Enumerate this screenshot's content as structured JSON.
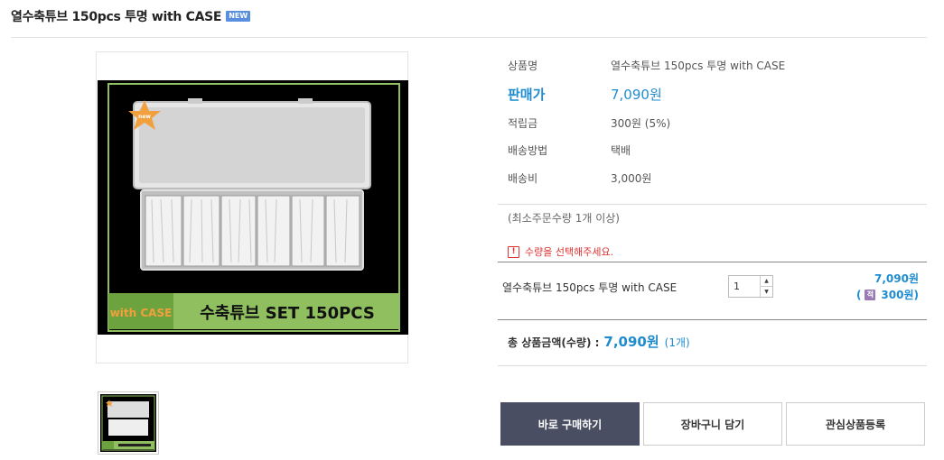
{
  "product": {
    "title": "열수축튜브 150pcs 투명 with CASE",
    "new_badge": "NEW"
  },
  "image": {
    "banner_left": "with CASE",
    "banner_right": "수축튜브 SET 150PCS",
    "star_label": "new"
  },
  "info": {
    "rows": [
      {
        "label": "상품명",
        "value": "열수축튜브 150pcs 투명 with CASE"
      },
      {
        "label": "판매가",
        "value": "7,090원"
      },
      {
        "label": "적립금",
        "value": "300원 (5%)"
      },
      {
        "label": "배송방법",
        "value": "택배"
      },
      {
        "label": "배송비",
        "value": "3,000원"
      }
    ],
    "min_qty": "(최소주문수량 1개 이상)",
    "warning": "수량을 선택해주세요."
  },
  "option": {
    "name": "열수축튜브 150pcs 투명 with CASE",
    "qty": "1",
    "price": "7,090원",
    "mileage_open": "(",
    "mileage": "300원)"
  },
  "total": {
    "label": "총 상품금액(수량) :",
    "amount": "7,090원",
    "count": "(1개)"
  },
  "buttons": {
    "buy": "바로 구매하기",
    "cart": "장바구니 담기",
    "wish": "관심상품등록"
  },
  "colors": {
    "accent": "#1f8ccf",
    "warning": "#dd3333",
    "buy_button": "#4a4e63",
    "banner_green": "#8fbf5e",
    "banner_orange": "#f2a03d"
  },
  "icons": {
    "warning": "exclamation-icon",
    "mileage": "mileage-icon",
    "qty_up": "caret-up-icon",
    "qty_down": "caret-down-icon"
  }
}
